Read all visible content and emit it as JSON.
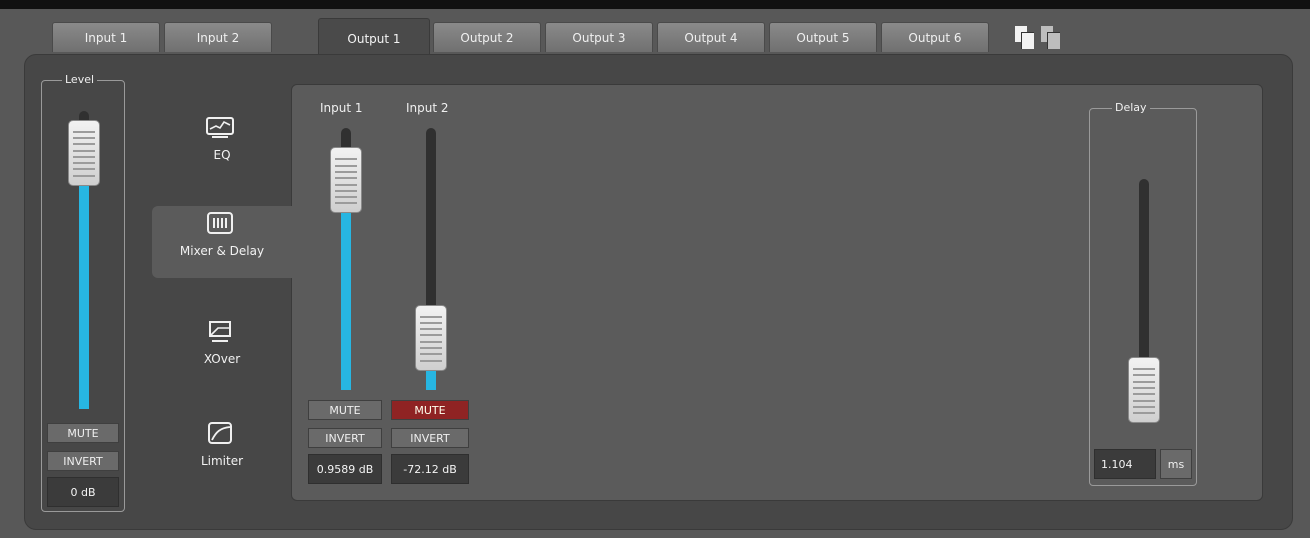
{
  "tabs": {
    "inputs": [
      "Input 1",
      "Input 2"
    ],
    "outputs": [
      "Output 1",
      "Output 2",
      "Output 3",
      "Output 4",
      "Output 5",
      "Output 6"
    ],
    "active": "Output 1",
    "tools": [
      {
        "icon": "copy-icon"
      },
      {
        "icon": "paste-icon"
      }
    ]
  },
  "level": {
    "label": "Level",
    "mute_label": "MUTE",
    "invert_label": "INVERT",
    "value": "0 dB",
    "level_fraction": 0.86,
    "accent": "#27b6e2"
  },
  "nav": {
    "items": [
      {
        "label": "EQ",
        "icon": "eq-icon"
      },
      {
        "label": "Mixer & Delay",
        "icon": "mixer-icon"
      },
      {
        "label": "XOver",
        "icon": "crossover-icon"
      },
      {
        "label": "Limiter",
        "icon": "limiter-icon"
      }
    ],
    "active": "Mixer & Delay"
  },
  "mixer": {
    "channels": [
      {
        "label": "Input 1",
        "mute_label": "MUTE",
        "muted": false,
        "invert_label": "INVERT",
        "value": "0.9589 dB",
        "level_fraction": 0.8
      },
      {
        "label": "Input 2",
        "mute_label": "MUTE",
        "muted": true,
        "invert_label": "INVERT",
        "value": "-72.12 dB",
        "level_fraction": 0.2
      }
    ],
    "mute_active_color": "#8f2323"
  },
  "delay": {
    "label": "Delay",
    "value": "1.104",
    "unit": "ms",
    "level_fraction": 0.12
  }
}
